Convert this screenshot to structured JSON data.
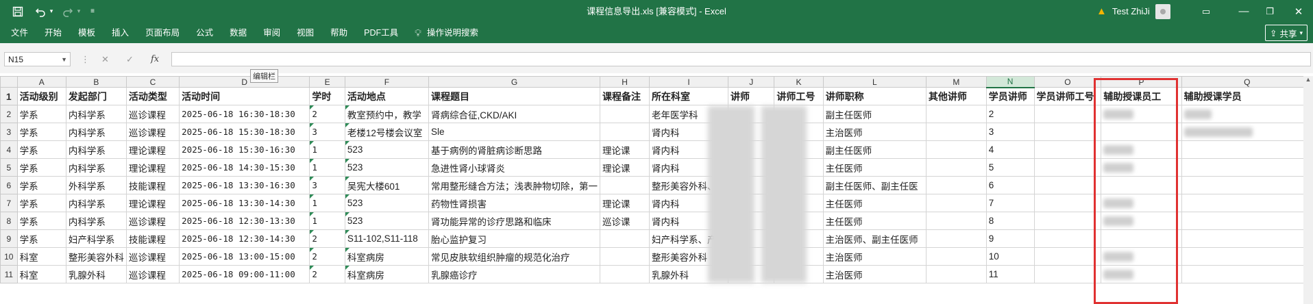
{
  "titlebar": {
    "doc_title": "课程信息导出.xls  [兼容模式]  -  Excel",
    "user_name": "Test ZhiJi",
    "icons": [
      "save-icon",
      "undo-icon",
      "redo-icon",
      "customize-icon",
      "ribbon-display-icon",
      "minimize-icon",
      "restore-icon",
      "close-icon"
    ]
  },
  "ribbon": {
    "tabs": [
      "文件",
      "开始",
      "模板",
      "插入",
      "页面布局",
      "公式",
      "数据",
      "审阅",
      "视图",
      "帮助",
      "PDF工具"
    ],
    "tell_me": "操作说明搜索",
    "share": "共享"
  },
  "formula_bar": {
    "name_box": "N15",
    "fx": "fx",
    "value": "",
    "tooltip": "编辑栏"
  },
  "sheet": {
    "columns": [
      "A",
      "B",
      "C",
      "D",
      "E",
      "F",
      "G",
      "H",
      "I",
      "J",
      "K",
      "L",
      "M",
      "N",
      "O",
      "P",
      "Q"
    ],
    "selected_column": "N",
    "headers": [
      "活动级别",
      "发起部门",
      "活动类型",
      "活动时间",
      "学时",
      "活动地点",
      "课程题目",
      "课程备注",
      "所在科室",
      "讲师",
      "讲师工号",
      "讲师职称",
      "其他讲师",
      "学员讲师",
      "学员讲师工号",
      "辅助授课员工",
      "辅助授课学员"
    ],
    "rows": [
      {
        "n": "2",
        "a": "学系",
        "b": "内科学系",
        "c": "巡诊课程",
        "d": "2025-06-18 16:30-18:30",
        "e": "2",
        "f": "教室预约中，教学",
        "g": "肾病综合征,CKD/AKI",
        "h": "",
        "i": "老年医学科",
        "l": "副主任医师",
        "p": true,
        "q": true
      },
      {
        "n": "3",
        "a": "学系",
        "b": "内科学系",
        "c": "巡诊课程",
        "d": "2025-06-18 15:30-18:30",
        "e": "3",
        "f": "老楼12号楼会议室",
        "g": "Sle",
        "h": "",
        "i": "肾内科",
        "l": "主治医师",
        "p": false,
        "q": true
      },
      {
        "n": "4",
        "a": "学系",
        "b": "内科学系",
        "c": "理论课程",
        "d": "2025-06-18 15:30-16:30",
        "e": "1",
        "f": "523",
        "g": "基于病例的肾脏病诊断思路",
        "h": "理论课",
        "i": "肾内科",
        "l": "副主任医师",
        "p": true,
        "q": false
      },
      {
        "n": "5",
        "a": "学系",
        "b": "内科学系",
        "c": "理论课程",
        "d": "2025-06-18 14:30-15:30",
        "e": "1",
        "f": "523",
        "g": "急进性肾小球肾炎",
        "h": "理论课",
        "i": "肾内科",
        "l": "主任医师",
        "p": true,
        "q": false
      },
      {
        "n": "6",
        "a": "学系",
        "b": "外科学系",
        "c": "技能课程",
        "d": "2025-06-18 13:30-16:30",
        "e": "3",
        "f": "吴宪大楼601",
        "g": "常用整形缝合方法；浅表肿物切除，第一",
        "h": "",
        "i": "整形美容外科、3",
        "l": "副主任医师、副主任医",
        "p": false,
        "q": false
      },
      {
        "n": "7",
        "a": "学系",
        "b": "内科学系",
        "c": "理论课程",
        "d": "2025-06-18 13:30-14:30",
        "e": "1",
        "f": "523",
        "g": "药物性肾损害",
        "h": "理论课",
        "i": "肾内科",
        "l": "主任医师",
        "p": true,
        "q": false
      },
      {
        "n": "8",
        "a": "学系",
        "b": "内科学系",
        "c": "巡诊课程",
        "d": "2025-06-18 12:30-13:30",
        "e": "1",
        "f": "523",
        "g": "肾功能异常的诊疗思路和临床",
        "h": "巡诊课",
        "i": "肾内科",
        "l": "主任医师",
        "p": true,
        "q": false
      },
      {
        "n": "9",
        "a": "学系",
        "b": "妇产科学系",
        "c": "技能课程",
        "d": "2025-06-18 12:30-14:30",
        "e": "2",
        "f": "S11-102,S11-118",
        "g": "胎心监护复习",
        "h": "",
        "i": "妇产科学系、产科",
        "l": "主治医师、副主任医师",
        "p": false,
        "q": false
      },
      {
        "n": "10",
        "a": "科室",
        "b": "整形美容外科",
        "c": "巡诊课程",
        "d": "2025-06-18 13:00-15:00",
        "e": "2",
        "f": "科室病房",
        "g": "常见皮肤软组织肿瘤的规范化治疗",
        "h": "",
        "i": "整形美容外科",
        "l": "主治医师",
        "p": true,
        "q": false
      },
      {
        "n": "11",
        "a": "科室",
        "b": "乳腺外科",
        "c": "巡诊课程",
        "d": "2025-06-18 09:00-11:00",
        "e": "2",
        "f": "科室病房",
        "g": "乳腺癌诊疗",
        "h": "",
        "i": "乳腺外科",
        "l": "主治医师",
        "p": true,
        "q": false
      }
    ]
  }
}
